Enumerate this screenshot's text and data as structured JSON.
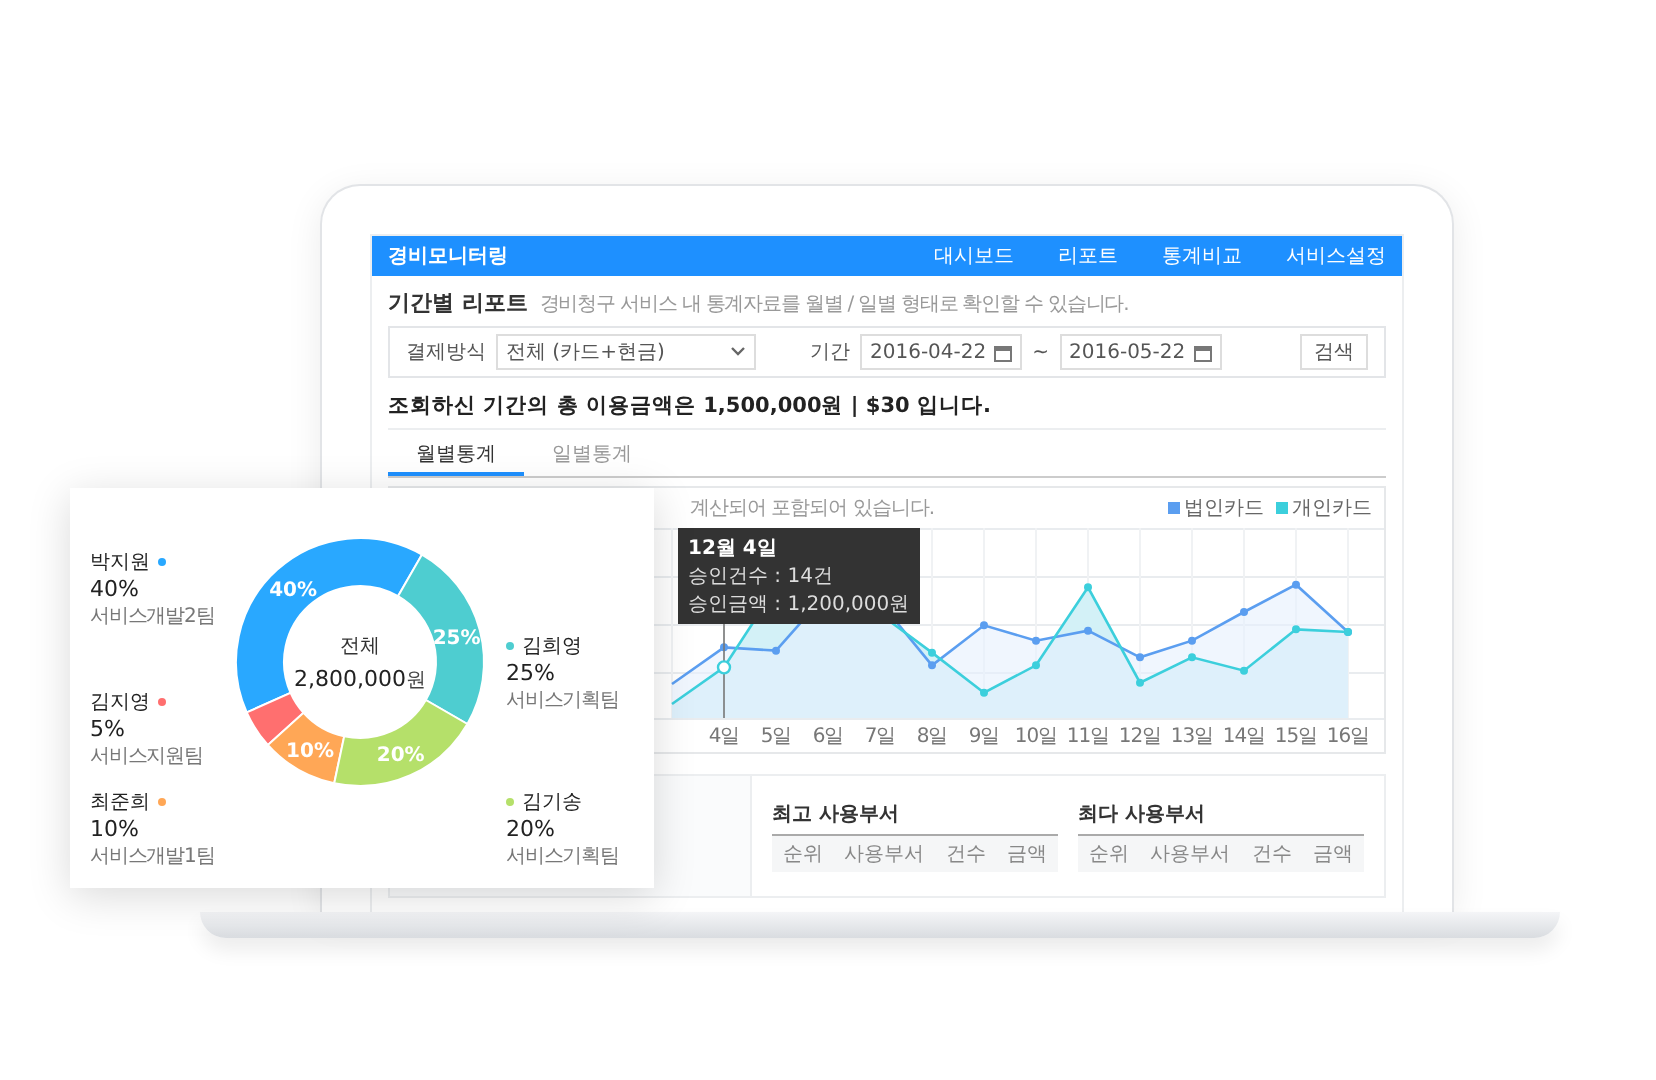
{
  "header": {
    "logo": "경비모니터링",
    "nav": [
      {
        "label": "대시보드"
      },
      {
        "label": "리포트"
      },
      {
        "label": "통계비교"
      },
      {
        "label": "서비스설정"
      }
    ]
  },
  "page": {
    "title": "기간별 리포트",
    "subtitle": "경비청구 서비스 내 통계자료를 월별 / 일별 형태로 확인할 수 있습니다."
  },
  "filter": {
    "payment_label": "결제방식",
    "payment_value": "전체 (카드+현금)",
    "period_label": "기간",
    "start_date": "2016-04-22",
    "separator": "~",
    "end_date": "2016-05-22",
    "search_button": "검색"
  },
  "summary": "조회하신 기간의 총 이용금액은 **1,500,000원** | **$30** 입니다.",
  "tabs": [
    {
      "label": "월별통계",
      "selected": true
    },
    {
      "label": "일별통계",
      "selected": false
    }
  ],
  "chart": {
    "note": "계산되어 포함되어 있습니다.",
    "legend": [
      {
        "label": "법인카드",
        "color": "#5b9ef0"
      },
      {
        "label": "개인카드",
        "color": "#3ccfdc"
      }
    ],
    "x_labels": [
      "4일",
      "5일",
      "6일",
      "7일",
      "8일",
      "9일",
      "10일",
      "11일",
      "12일",
      "13일",
      "14일",
      "15일",
      "16일"
    ],
    "tooltip": {
      "title": "12월 4일",
      "lines": [
        "승인건수 : 14건",
        "승인금액 : 1,200,000원"
      ]
    }
  },
  "bottom": {
    "tables": [
      {
        "title": "최고 사용부서",
        "columns": [
          "순위",
          "사용부서",
          "건수",
          "금액"
        ]
      },
      {
        "title": "최다 사용부서",
        "columns": [
          "순위",
          "사용부서",
          "건수",
          "금액"
        ]
      }
    ]
  },
  "donut_card": {
    "center_label": "전체",
    "center_amount": "2,800,000",
    "center_unit": "원",
    "chart_data": {
      "type": "donut",
      "categories": [
        "박지원",
        "김희영",
        "김지영",
        "최준희",
        "김기송"
      ],
      "values": [
        40,
        25,
        5,
        10,
        20
      ]
    },
    "people": [
      {
        "percent": "40%",
        "team": "서비스개발2팀",
        "slice_label": "40%",
        "color": "#29a8ff"
      },
      {
        "percent": "25%",
        "team": "서비스기획팀",
        "slice_label": "25%",
        "color": "#4ecdd0"
      },
      {
        "percent": "5%",
        "team": "서비스지원팀",
        "color": "#ff6f6f"
      },
      {
        "percent": "10%",
        "team": "서비스개발1팀",
        "slice_label": "10%",
        "color": "#ffa756"
      },
      {
        "percent": "20%",
        "team": "서비스기획팀",
        "slice_label": "20%",
        "color": "#b5e06a"
      }
    ]
  }
}
